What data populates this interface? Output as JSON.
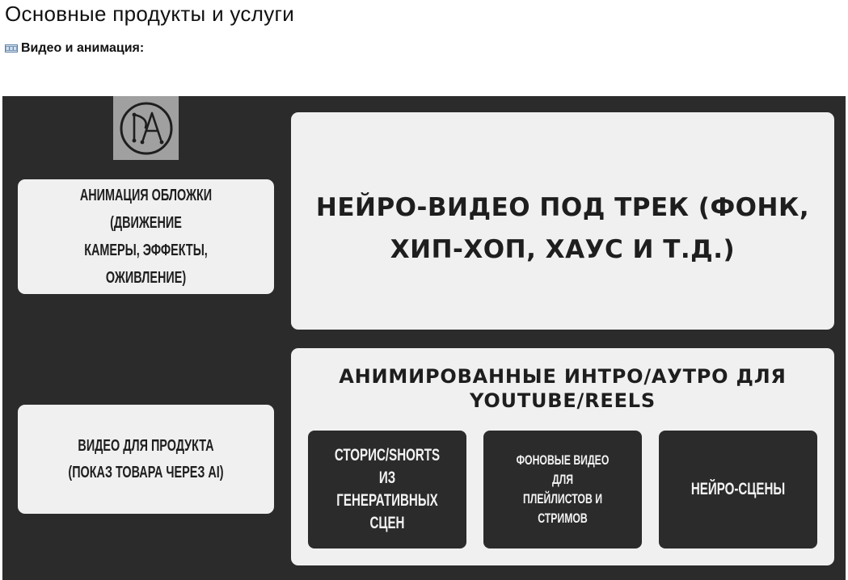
{
  "page": {
    "title": "Основные продукты и услуги"
  },
  "section": {
    "icon": "film-frames-icon",
    "heading": "Видео и анимация:"
  },
  "slide": {
    "background_color": "#2b2b2b",
    "card_color": "#f0f0f0",
    "logo": {
      "icon": "da-monogram-logo",
      "letters": "DA"
    },
    "cover_animation": "Анимация обложки (движение\nкамеры, эффекты, оживление)",
    "product_video": "Видео для продукта\n(показ товара через AI)",
    "neuro_video": "Нейро-видео под трек (фонк,\nхип-хоп, хаус и т.д.)",
    "intro_outro": "Анимированные интро/аутро для\nYouTube/Reels",
    "stories": "Сторис/Shorts\nиз генеративных\nсцен",
    "background_video": "Фоновые видео для\nплейлистов и\nстримов",
    "neuro_scenes": "Нейро-сцены"
  }
}
